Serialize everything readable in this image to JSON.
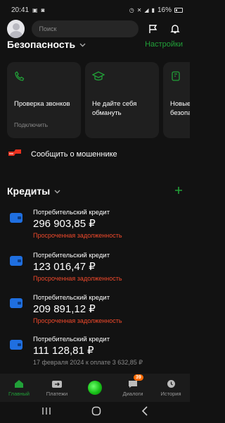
{
  "status_bar": {
    "time": "20:41",
    "battery": "16%"
  },
  "header": {
    "search_placeholder": "Поиск"
  },
  "security": {
    "title": "Безопасность",
    "action": "Настройки",
    "cards": [
      {
        "title": "Проверка звонков",
        "subtitle": "Подключить",
        "icon": "phone-icon"
      },
      {
        "title": "Не дайте себя обмануть",
        "subtitle": "",
        "icon": "graduation-cap-icon"
      },
      {
        "title": "Новые сервисы безопасности",
        "subtitle": "",
        "icon": "shield-doc-icon"
      }
    ],
    "report_label": "Сообщить о мошеннике"
  },
  "credits": {
    "title": "Кредиты",
    "items": [
      {
        "name": "Потребительский кредит",
        "amount": "296 903,85 ₽",
        "status": "Просроченная задолженность"
      },
      {
        "name": "Потребительский кредит",
        "amount": "123 016,47 ₽",
        "status": "Просроченная задолженность"
      },
      {
        "name": "Потребительский кредит",
        "amount": "209 891,12 ₽",
        "status": "Просроченная задолженность"
      },
      {
        "name": "Потребительский кредит",
        "amount": "111 128,81 ₽",
        "note": "17 февраля 2024 к оплате 3 632,85 ₽"
      }
    ]
  },
  "tabs": [
    {
      "label": "Главный",
      "active": true
    },
    {
      "label": "Платежи"
    },
    {
      "label": ""
    },
    {
      "label": "Диалоги",
      "badge": "39"
    },
    {
      "label": "История"
    }
  ],
  "colors": {
    "accent": "#21a038",
    "danger": "#f0492b",
    "wallet": "#1f6fe0",
    "background": "#121212"
  }
}
